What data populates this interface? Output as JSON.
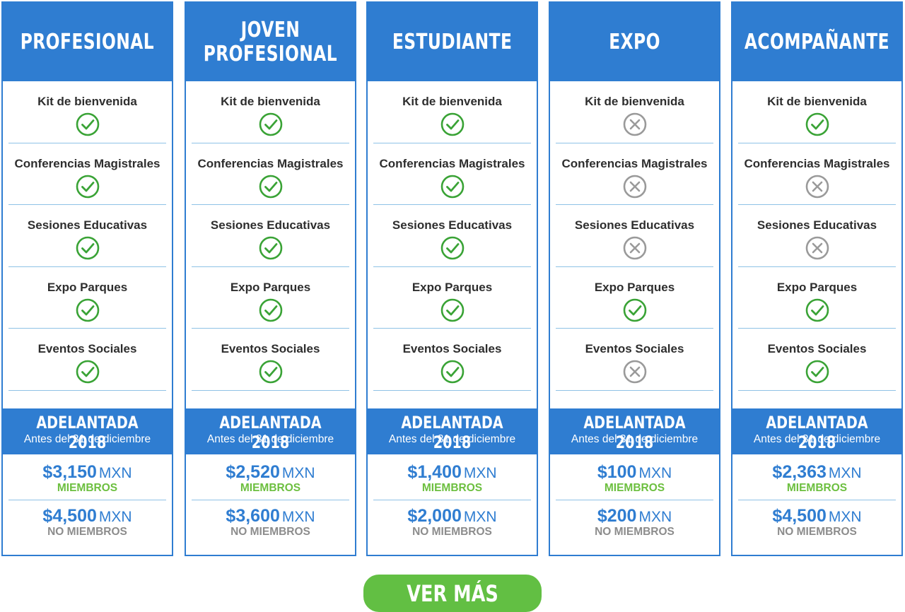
{
  "band": {
    "title": "ADELANTADA 2018",
    "subtitle": "Antes del 31 de diciembre"
  },
  "currency": "MXN",
  "member_label": "MIEMBROS",
  "nonmember_label": "NO MIEMBROS",
  "colors": {
    "primary": "#2f7dd1",
    "check": "#3aa336",
    "cross": "#9a9a9a",
    "member": "#6cbf3f",
    "button": "#62bf43"
  },
  "plans": [
    {
      "name": "PROFESIONAL",
      "features": [
        {
          "label": "Kit de bienvenida",
          "included": true,
          "icon": "check-circle-icon"
        },
        {
          "label": "Conferencias Magistrales",
          "included": true,
          "icon": "check-circle-icon"
        },
        {
          "label": "Sesiones Educativas",
          "included": true,
          "icon": "check-circle-icon"
        },
        {
          "label": "Expo Parques",
          "included": true,
          "icon": "check-circle-icon"
        },
        {
          "label": "Eventos Sociales",
          "included": true,
          "icon": "check-circle-icon"
        }
      ],
      "member_price": "$3,150",
      "nonmember_price": "$4,500"
    },
    {
      "name": "JOVEN\nPROFESIONAL",
      "features": [
        {
          "label": "Kit de bienvenida",
          "included": true,
          "icon": "check-circle-icon"
        },
        {
          "label": "Conferencias Magistrales",
          "included": true,
          "icon": "check-circle-icon"
        },
        {
          "label": "Sesiones Educativas",
          "included": true,
          "icon": "check-circle-icon"
        },
        {
          "label": "Expo Parques",
          "included": true,
          "icon": "check-circle-icon"
        },
        {
          "label": "Eventos Sociales",
          "included": true,
          "icon": "check-circle-icon"
        }
      ],
      "member_price": "$2,520",
      "nonmember_price": "$3,600"
    },
    {
      "name": "ESTUDIANTE",
      "features": [
        {
          "label": "Kit de bienvenida",
          "included": true,
          "icon": "check-circle-icon"
        },
        {
          "label": "Conferencias Magistrales",
          "included": true,
          "icon": "check-circle-icon"
        },
        {
          "label": "Sesiones Educativas",
          "included": true,
          "icon": "check-circle-icon"
        },
        {
          "label": "Expo Parques",
          "included": true,
          "icon": "check-circle-icon"
        },
        {
          "label": "Eventos Sociales",
          "included": true,
          "icon": "check-circle-icon"
        }
      ],
      "member_price": "$1,400",
      "nonmember_price": "$2,000"
    },
    {
      "name": "EXPO",
      "features": [
        {
          "label": "Kit de bienvenida",
          "included": false,
          "icon": "cross-circle-icon"
        },
        {
          "label": "Conferencias Magistrales",
          "included": false,
          "icon": "cross-circle-icon"
        },
        {
          "label": "Sesiones Educativas",
          "included": false,
          "icon": "cross-circle-icon"
        },
        {
          "label": "Expo Parques",
          "included": true,
          "icon": "check-circle-icon"
        },
        {
          "label": "Eventos Sociales",
          "included": false,
          "icon": "cross-circle-icon"
        }
      ],
      "member_price": "$100",
      "nonmember_price": "$200"
    },
    {
      "name": "ACOMPAÑANTE",
      "features": [
        {
          "label": "Kit de bienvenida",
          "included": true,
          "icon": "check-circle-icon"
        },
        {
          "label": "Conferencias Magistrales",
          "included": false,
          "icon": "cross-circle-icon"
        },
        {
          "label": "Sesiones Educativas",
          "included": false,
          "icon": "cross-circle-icon"
        },
        {
          "label": "Expo Parques",
          "included": true,
          "icon": "check-circle-icon"
        },
        {
          "label": "Eventos Sociales",
          "included": true,
          "icon": "check-circle-icon"
        }
      ],
      "member_price": "$2,363",
      "nonmember_price": "$4,500"
    }
  ],
  "cta": {
    "label": "VER MÁS"
  }
}
